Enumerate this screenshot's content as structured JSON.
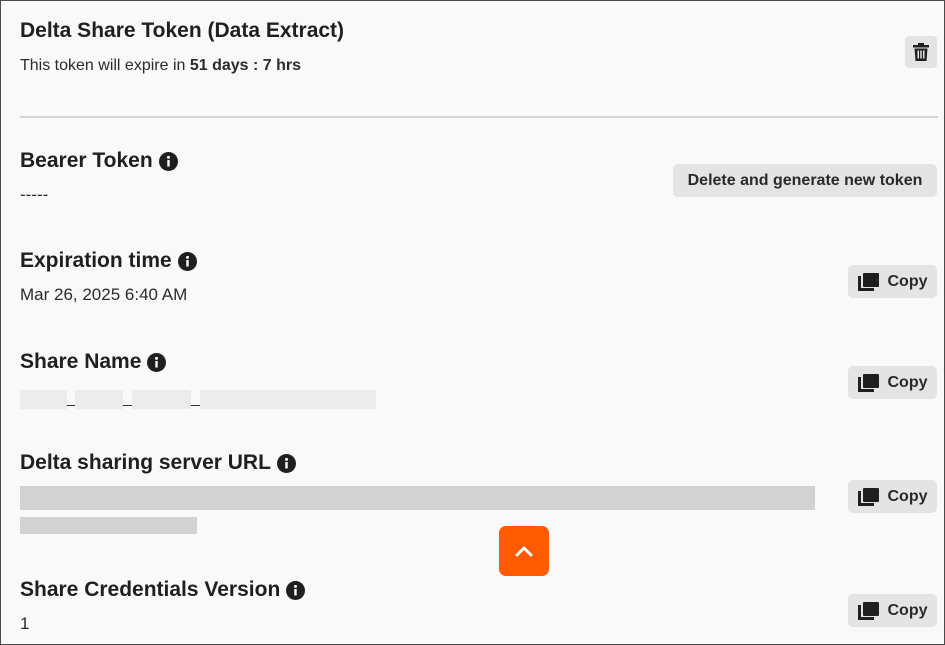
{
  "header": {
    "title": "Delta Share Token (Data Extract)",
    "expire_prefix": "This token will expire in ",
    "expire_value": "51 days : 7 hrs"
  },
  "bearer_token": {
    "label": "Bearer Token",
    "value": "-----",
    "regenerate_label": "Delete and generate new token"
  },
  "expiration": {
    "label": "Expiration time",
    "value": "Mar 26, 2025 6:40 AM",
    "copy_label": "Copy"
  },
  "share_name": {
    "label": "Share Name",
    "separators": [
      "_",
      "_",
      "_"
    ],
    "copy_label": "Copy"
  },
  "server_url": {
    "label": "Delta sharing server URL",
    "copy_label": "Copy"
  },
  "credentials_version": {
    "label": "Share Credentials Version",
    "value": "1",
    "copy_label": "Copy"
  },
  "icons": {
    "trash": "trash-icon",
    "info": "info-icon",
    "copy": "copy-icon",
    "scroll_up": "chevron-up-icon"
  },
  "colors": {
    "accent": "#ff5a00",
    "button_bg": "#e4e4e4",
    "panel_bg": "#f9f9f9"
  }
}
